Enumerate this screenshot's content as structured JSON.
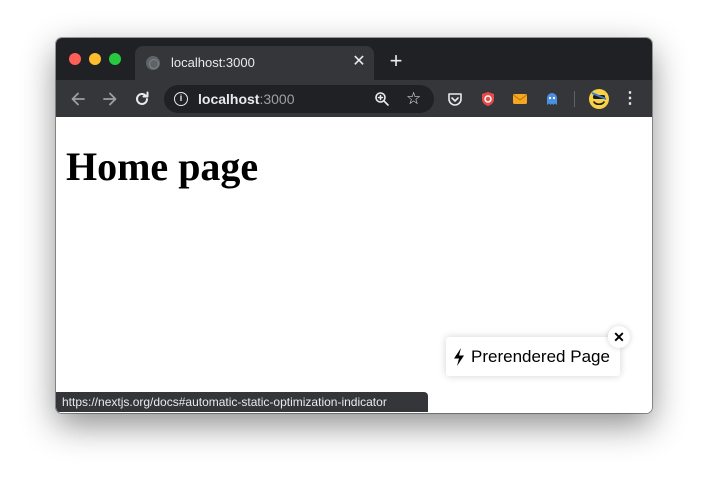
{
  "tab": {
    "title": "localhost:3000",
    "close_label": "✕"
  },
  "tabstrip": {
    "new_tab_label": "+"
  },
  "toolbar": {
    "omnibox": {
      "host": "localhost",
      "port": ":3000"
    },
    "icons": [
      "back-arrow-icon",
      "forward-arrow-icon",
      "reload-icon",
      "info-icon",
      "zoom-icon",
      "star-icon",
      "pocket-icon",
      "shield-icon",
      "mail-icon",
      "ghost-icon",
      "profile-avatar-icon",
      "menu-dots-icon"
    ]
  },
  "page": {
    "title": "Home page"
  },
  "indicator": {
    "label": "Prerendered Page",
    "close_label": "✕"
  },
  "status_bar": {
    "url": "https://nextjs.org/docs#automatic-static-optimization-indicator"
  },
  "colors": {
    "tabstrip": "#202124",
    "toolbar": "#35363a",
    "traffic_red": "#ff5f57",
    "traffic_yellow": "#febc2e",
    "traffic_green": "#28c840",
    "ext_pocket": "#ee4056",
    "ext_shield": "#e64a4a",
    "ext_mail": "#f5a623",
    "ext_ghost": "#4a90e2",
    "avatar": "#f8d147"
  }
}
